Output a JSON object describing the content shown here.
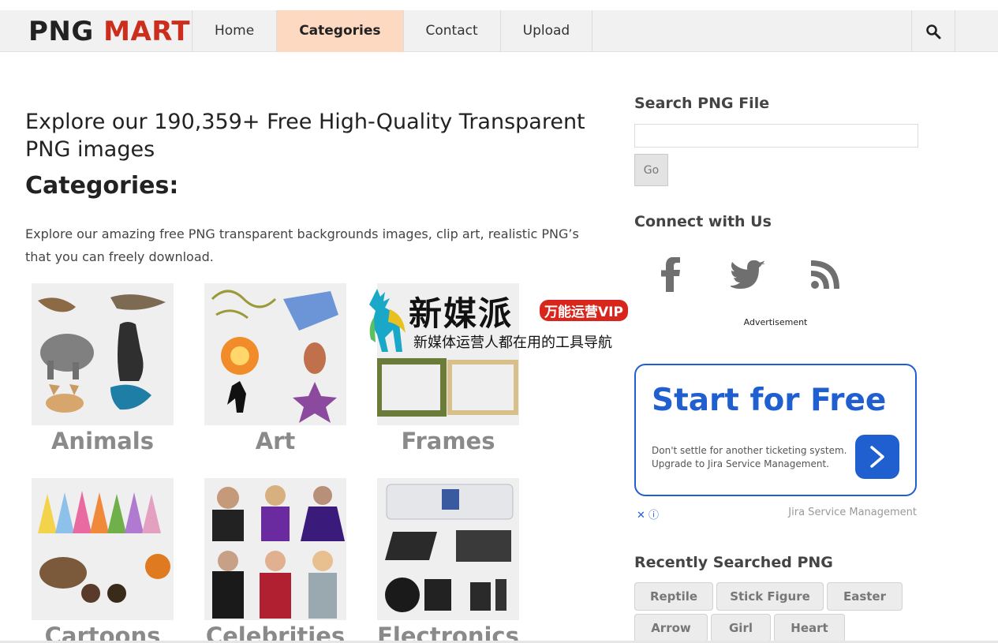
{
  "header": {
    "logo_part1": "PNG",
    "logo_part2": "MART",
    "nav": [
      {
        "label": "Home"
      },
      {
        "label": "Categories"
      },
      {
        "label": "Contact"
      },
      {
        "label": "Upload"
      }
    ],
    "search_icon": "search-icon"
  },
  "main": {
    "headline": "Explore our 190,359+ Free High-Quality Transparent PNG images",
    "categories_title": "Categories:",
    "intro": "Explore our amazing free PNG transparent backgrounds images, clip art, realistic PNG’s that you can freely download.",
    "categories": [
      {
        "label": "Animals"
      },
      {
        "label": "Art"
      },
      {
        "label": "Frames"
      },
      {
        "label": "Cartoons"
      },
      {
        "label": "Celebrities"
      },
      {
        "label": "Electronics"
      }
    ]
  },
  "watermark": {
    "title": "新媒派",
    "badge": "万能运营VIP",
    "subtitle": "新媒体运营人都在用的工具导航"
  },
  "sidebar": {
    "search_heading": "Search PNG File",
    "search_value": "",
    "go_label": "Go",
    "connect_heading": "Connect with Us",
    "social_icons": [
      "facebook-icon",
      "twitter-icon",
      "rss-icon"
    ],
    "ad_label": "Advertisement",
    "ad": {
      "headline": "Start for Free",
      "text": "Don't settle for another ticketing system. Upgrade to Jira Service Management.",
      "sponsor": "Jira Service Management"
    },
    "recent_heading": "Recently Searched PNG",
    "tags": [
      "Reptile",
      "Stick Figure",
      "Easter",
      "Arrow",
      "Girl",
      "Heart"
    ]
  },
  "colors": {
    "logo_accent": "#cc2e1e",
    "nav_active_bg": "#fdd9c1",
    "ad_blue": "#1f5fcf"
  }
}
